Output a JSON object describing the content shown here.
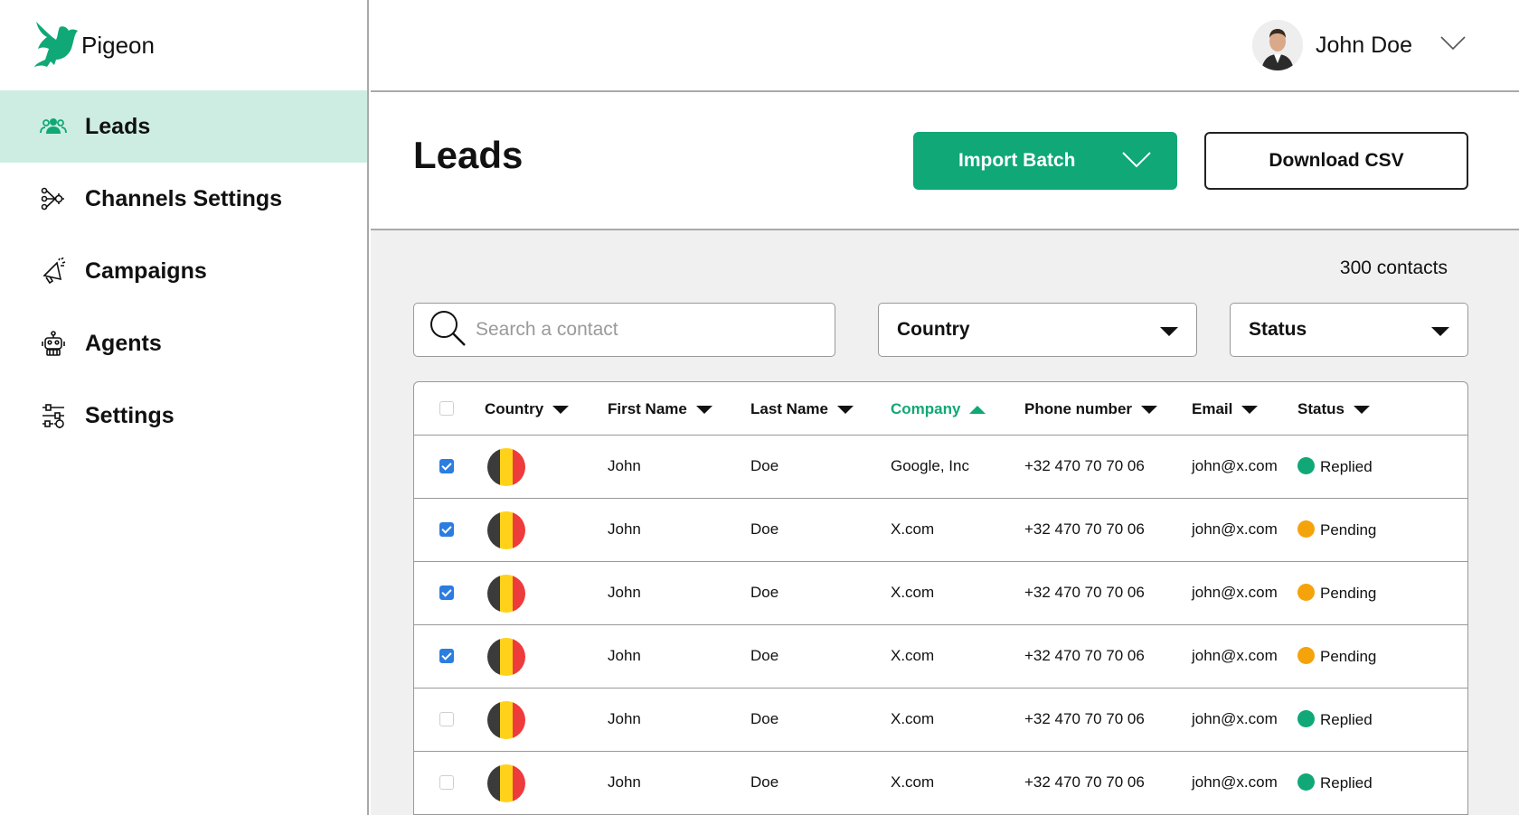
{
  "app": {
    "name": "Pigeon",
    "accent": "#0fa876",
    "active_bg": "#cdede2"
  },
  "sidebar": {
    "items": [
      {
        "label": "Leads",
        "icon": "users-icon",
        "active": true
      },
      {
        "label": "Channels Settings",
        "icon": "channels-icon",
        "active": false
      },
      {
        "label": "Campaigns",
        "icon": "megaphone-icon",
        "active": false
      },
      {
        "label": "Agents",
        "icon": "robot-icon",
        "active": false
      },
      {
        "label": "Settings",
        "icon": "sliders-icon",
        "active": false
      }
    ]
  },
  "user": {
    "name": "John Doe"
  },
  "header": {
    "title": "Leads",
    "import_label": "Import Batch",
    "download_label": "Download CSV"
  },
  "content": {
    "count": "300 contacts",
    "search_placeholder": "Search a contact",
    "country_filter": "Country",
    "status_filter": "Status"
  },
  "table": {
    "columns": [
      {
        "label": "Country",
        "sort": "desc"
      },
      {
        "label": "First Name",
        "sort": "desc"
      },
      {
        "label": "Last Name",
        "sort": "desc"
      },
      {
        "label": "Company",
        "sort": "asc",
        "active": true
      },
      {
        "label": "Phone number",
        "sort": "desc"
      },
      {
        "label": "Email",
        "sort": "desc"
      },
      {
        "label": "Status",
        "sort": "desc"
      }
    ],
    "status_colors": {
      "Replied": "#0fa876",
      "Pending": "#f5a30a"
    },
    "rows": [
      {
        "checked": true,
        "country": "Belgium",
        "first": "John",
        "last": "Doe",
        "company": "Google, Inc",
        "phone": "+32 470 70 70 06",
        "email": "john@x.com",
        "status": "Replied"
      },
      {
        "checked": true,
        "country": "Belgium",
        "first": "John",
        "last": "Doe",
        "company": "X.com",
        "phone": "+32 470 70 70 06",
        "email": "john@x.com",
        "status": "Pending"
      },
      {
        "checked": true,
        "country": "Belgium",
        "first": "John",
        "last": "Doe",
        "company": "X.com",
        "phone": "+32 470 70 70 06",
        "email": "john@x.com",
        "status": "Pending"
      },
      {
        "checked": true,
        "country": "Belgium",
        "first": "John",
        "last": "Doe",
        "company": "X.com",
        "phone": "+32 470 70 70 06",
        "email": "john@x.com",
        "status": "Pending"
      },
      {
        "checked": false,
        "country": "Belgium",
        "first": "John",
        "last": "Doe",
        "company": "X.com",
        "phone": "+32 470 70 70 06",
        "email": "john@x.com",
        "status": "Replied"
      },
      {
        "checked": false,
        "country": "Belgium",
        "first": "John",
        "last": "Doe",
        "company": "X.com",
        "phone": "+32 470 70 70 06",
        "email": "john@x.com",
        "status": "Replied"
      }
    ]
  }
}
